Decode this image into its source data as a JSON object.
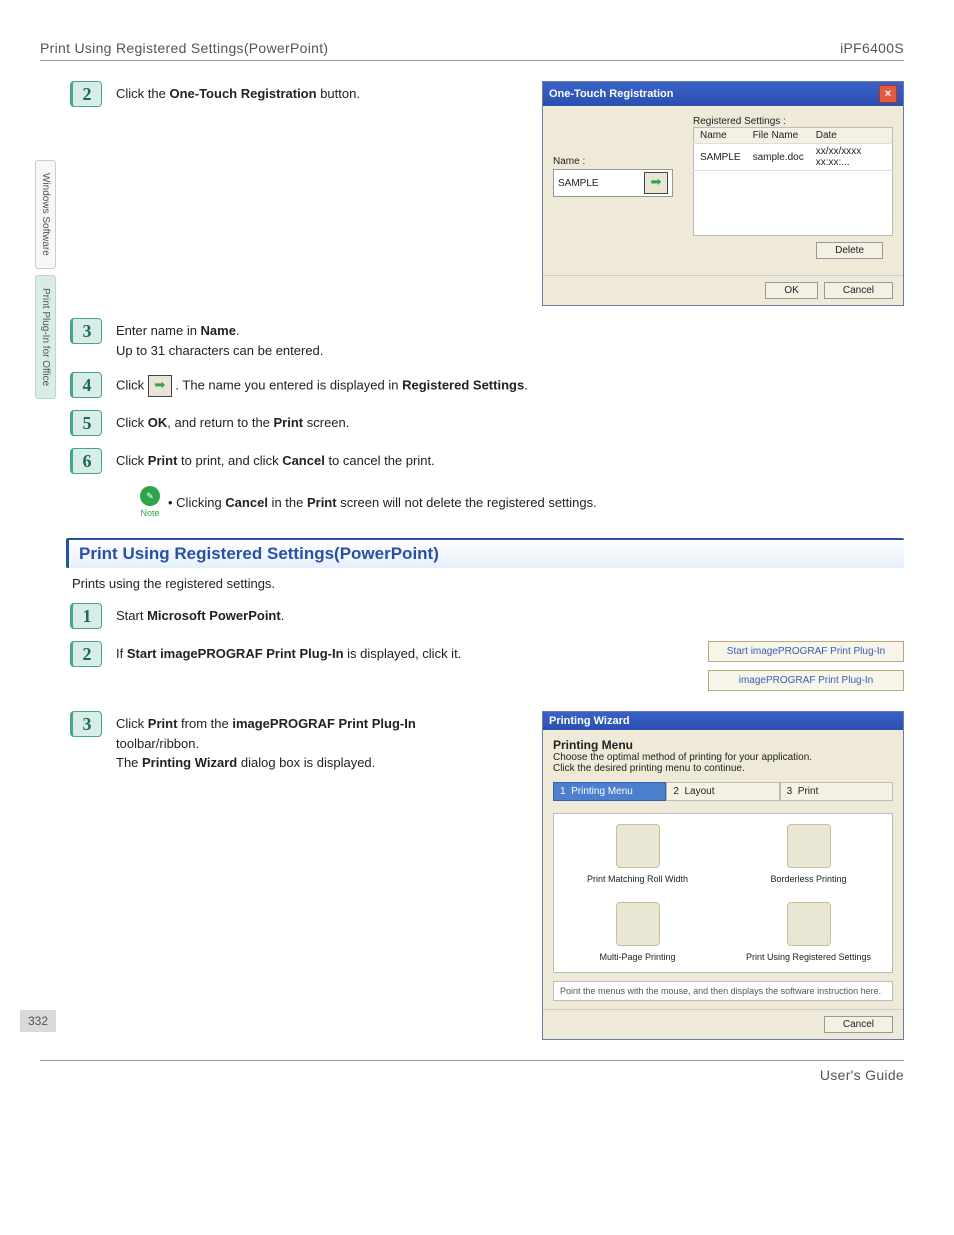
{
  "header": {
    "left": "Print Using Registered Settings(PowerPoint)",
    "right": "iPF6400S"
  },
  "sidebar": {
    "tab1": "Windows Software",
    "tab2": "Print Plug-In for Office"
  },
  "stepsA": {
    "s2": {
      "num": "2",
      "pre": "Click the ",
      "bold": "One-Touch Registration",
      "post": " button."
    },
    "s3": {
      "num": "3",
      "line1_pre": "Enter name in ",
      "line1_bold": "Name",
      "line1_post": ".",
      "line2": "Up to 31 characters can be entered."
    },
    "s4": {
      "num": "4",
      "pre": "Click ",
      "mid": ". The name you entered is displayed in ",
      "bold": "Registered Settings",
      "post": "."
    },
    "s5": {
      "num": "5",
      "pre": "Click ",
      "bold": "OK",
      "mid": ", and return to the ",
      "bold2": "Print",
      "post": " screen."
    },
    "s6": {
      "num": "6",
      "pre": "Click ",
      "bold": "Print",
      "mid": " to print, and click ",
      "bold2": "Cancel",
      "post": " to cancel the print."
    }
  },
  "note": {
    "label": "Note",
    "pre": "Clicking ",
    "b1": "Cancel",
    "mid": " in the ",
    "b2": "Print",
    "post": " screen will not delete the registered settings."
  },
  "section": {
    "title": "Print Using Registered Settings(PowerPoint)",
    "desc": "Prints using the registered settings."
  },
  "stepsB": {
    "s1": {
      "num": "1",
      "pre": "Start ",
      "bold": "Microsoft PowerPoint",
      "post": "."
    },
    "s2": {
      "num": "2",
      "pre": "If ",
      "bold": "Start imagePROGRAF Print Plug-In",
      "post": " is displayed, click it."
    },
    "s3": {
      "num": "3",
      "pre": "Click ",
      "b1": "Print",
      "mid1": " from the ",
      "b2": "imagePROGRAF Print Plug-In",
      "mid2": " toolbar/ribbon.",
      "l2_pre": "The ",
      "l2_b": "Printing Wizard",
      "l2_post": " dialog box is displayed."
    }
  },
  "otrDialog": {
    "title": "One-Touch Registration",
    "nameLabel": "Name :",
    "nameValue": "SAMPLE",
    "regLabel": "Registered Settings :",
    "cols": {
      "c1": "Name",
      "c2": "File Name",
      "c3": "Date"
    },
    "row": {
      "c1": "SAMPLE",
      "c2": "sample.doc",
      "c3": "xx/xx/xxxx xx:xx:..."
    },
    "delete": "Delete",
    "ok": "OK",
    "cancel": "Cancel"
  },
  "toolbar": {
    "btn1": "Start imagePROGRAF Print Plug-In",
    "btn2": "imagePROGRAF Print Plug-In"
  },
  "pwDialog": {
    "title": "Printing Wizard",
    "menuTitle": "Printing Menu",
    "desc1": "Choose the optimal method of printing for your application.",
    "desc2": "Click the desired printing menu to continue.",
    "step1n": "1",
    "step1": "Printing Menu",
    "step2n": "2",
    "step2": "Layout",
    "step3n": "3",
    "step3": "Print",
    "opt1": "Print Matching Roll Width",
    "opt2": "Borderless Printing",
    "opt3": "Multi-Page Printing",
    "opt4": "Print Using Registered Settings",
    "hint": "Point the menus with the mouse, and then displays the software instruction here.",
    "cancel": "Cancel"
  },
  "pageNumber": "332",
  "footer": "User's Guide"
}
